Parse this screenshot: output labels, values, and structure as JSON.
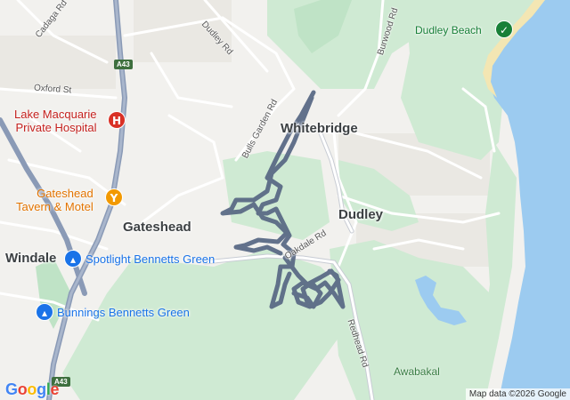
{
  "map": {
    "places": {
      "whitebridge": "Whitebridge",
      "gateshead": "Gateshead",
      "dudley": "Dudley",
      "windale": "Windale"
    },
    "roads": {
      "cadaga": "Cadaga Rd",
      "dudley_rd": "Dudley Rd",
      "oxford": "Oxford St",
      "bulls_garden": "Bulls Garden Rd",
      "burwood": "Burwood Rd",
      "oakdale": "Oakdale Rd",
      "redhead": "Redhead Rd"
    },
    "shields": {
      "top": "A43",
      "bottom": "A43"
    },
    "pois": {
      "hospital": "Lake Macquarie\nPrivate Hospital",
      "tavern": "Gateshead\nTavern & Motel",
      "spotlight": "Spotlight Bennetts Green",
      "bunnings": "Bunnings Bennetts Green",
      "dudley_beach": "Dudley Beach",
      "awabakal": "Awabakal"
    },
    "icons": {
      "hospital": "hospital-icon",
      "tavern": "cocktail-bar-icon",
      "spotlight": "shopping-bag-icon",
      "bunnings": "shopping-bag-icon",
      "beach": "beach-icon"
    },
    "colors": {
      "route": "#5b6b86",
      "water": "#9ccbf0",
      "park": "#cfead3",
      "land": "#f2f1ee",
      "road": "#ffffff",
      "highway": "#8a9ab6"
    },
    "attribution": "Map data ©2026 Google",
    "logo": "Google"
  }
}
